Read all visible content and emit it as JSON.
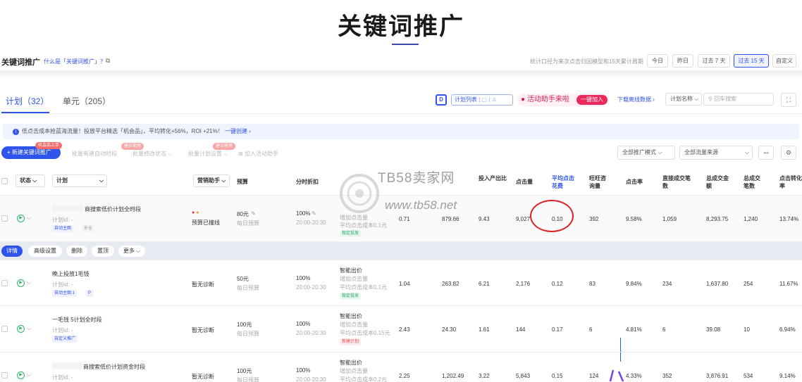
{
  "page_title": "关键词推广",
  "header": {
    "name": "关键词推广",
    "what_link": "什么是「关键词推广」？",
    "ext_icon": "external-link-icon",
    "stat_note": "统计口径为来次点击归因模型和15天累计周期",
    "date_buttons": [
      "今日",
      "昨日",
      "过去 7 天",
      "过去 15 天",
      "自定义"
    ],
    "date_selected": "过去 15 天"
  },
  "tabs": {
    "plan": "计划（32）",
    "unit": "单元（205）",
    "plan_list": "计划列表",
    "promo": "活动助手来啦",
    "promo_btn": "一键加入",
    "download": "下载离线数据",
    "filter": "计划名称",
    "search_placeholder": "回车搜索"
  },
  "notice": {
    "text": "低点击成本抢蓝海流量！投放平台精选「机会品」，平均转化+56%，ROI +21%！",
    "link": "一键创建"
  },
  "toolbar": {
    "new": "+ 新建关键词推广",
    "new_tag": "机会品上手",
    "batch_time": "批量新建自动时段",
    "batch_time_tag": "建议使用",
    "batch_status": "批量修改状态",
    "batch_plan": "批量计划设置",
    "batch_plan_tag": "建议使用",
    "join": "加入活动助手",
    "mode": "全部推广模式",
    "source": "全部流量来源"
  },
  "columns": {
    "status": "状态",
    "plan": "计划",
    "assistant": "营销助手",
    "budget": "预算",
    "discount": "分时折扣",
    "roi": "投入产出比",
    "clicks": "点击量",
    "avg_cost": "平均点击花费",
    "ww": "旺旺咨询量",
    "ctr": "点击率",
    "direct_deals": "直接成交笔数",
    "total_amount": "总成交金额",
    "total_deals": "总成交笔数",
    "conv": "点击转化率"
  },
  "actions": [
    "详情",
    "高级设置",
    "删除",
    "置顶",
    "更多"
  ],
  "rows": [
    {
      "name": "商搜索低价计划全时段",
      "plan_id": "计划id: -",
      "tags": [
        "自动主图",
        "补全"
      ],
      "assist_status": "预算已撞线",
      "budget": "80元",
      "budget_sub": "每日预算",
      "discount": "100%",
      "time": "20:00-20:30",
      "bid1": "增加点击量",
      "bid2": "平均点击成本0.1元",
      "bid_tag": "稳定投放",
      "c5": "0.71",
      "c6": "879.66",
      "roi": "9.43",
      "clicks": "9,027",
      "avg": "0.10",
      "ww": "392",
      "ctr": "9.58%",
      "dd": "1,059",
      "amount": "8,293.75",
      "deals": "1,240",
      "conv": "13.74%"
    },
    {
      "name": "晚上投放1毛钱",
      "plan_id": "计划id: -",
      "tags": [
        "自动主图 1",
        "P"
      ],
      "assist_status": "暂无诊断",
      "budget": "50元",
      "budget_sub": "每日预算",
      "discount": "100%",
      "time": "20:00-20:30",
      "bid0": "智能出价",
      "bid1": "增加点击量",
      "bid2": "平均点击成本0.1元",
      "bid_tag": "稳定投放",
      "c5": "1.04",
      "c6": "263.82",
      "roi": "6.21",
      "clicks": "2,176",
      "avg": "0.12",
      "ww": "83",
      "ctr": "9.84%",
      "dd": "234",
      "amount": "1,637.80",
      "deals": "254",
      "conv": "11.67%"
    },
    {
      "name": "一毛钱    5计划全时段",
      "plan_id": "计划id: -",
      "tags": [
        "自定义推广"
      ],
      "assist_status": "暂无诊断",
      "budget": "100元",
      "budget_sub": "每日预算",
      "discount": "100%",
      "time": "20:00-20:30",
      "bid0": "智能出价",
      "bid1": "增加点击量",
      "bid2": "平均点击成本0.15元",
      "bid_tag": "新建计划",
      "c5": "2.43",
      "c6": "24.30",
      "roi": "1.61",
      "clicks": "144",
      "avg": "0.17",
      "ww": "6",
      "ctr": "4.81%",
      "dd": "6",
      "amount": "39.08",
      "deals": "10",
      "conv": "6.94%"
    },
    {
      "name": "商搜索低价计划资金时段",
      "plan_id": "计划id: -",
      "tags": [],
      "assist_status": "暂无诊断",
      "budget": "100元",
      "budget_sub": "每日预算",
      "discount": "100%",
      "time": "20:00-20:30",
      "bid0": "智能出价",
      "bid1": "增加点击量",
      "bid2": "平均点击成本0.2元",
      "bid_tag": "",
      "c5": "2.25",
      "c6": "1,202.49",
      "roi": "3.22",
      "clicks": "5,843",
      "avg": "0.15",
      "ww": "124",
      "ctr": "4.33%",
      "dd": "352",
      "amount": "3,876.91",
      "deals": "534",
      "conv": "9.14%"
    }
  ],
  "watermark": {
    "brand": "TB58卖家网",
    "url": "www.tb58.net"
  }
}
